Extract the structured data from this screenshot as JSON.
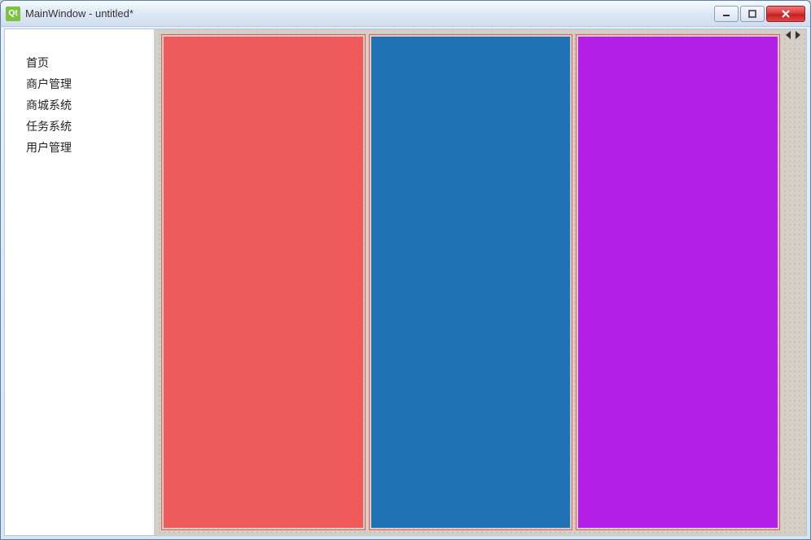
{
  "window": {
    "title": "MainWindow - untitled*",
    "app_icon_label": "Qt"
  },
  "sidebar": {
    "items": [
      {
        "label": "首页"
      },
      {
        "label": "商户管理"
      },
      {
        "label": "商城系统"
      },
      {
        "label": "任务系统"
      },
      {
        "label": "用户管理"
      }
    ]
  },
  "panels": [
    {
      "name": "panel-red",
      "color": "#ef5b5b"
    },
    {
      "name": "panel-blue",
      "color": "#2171b5"
    },
    {
      "name": "panel-purple",
      "color": "#b520e8"
    }
  ]
}
